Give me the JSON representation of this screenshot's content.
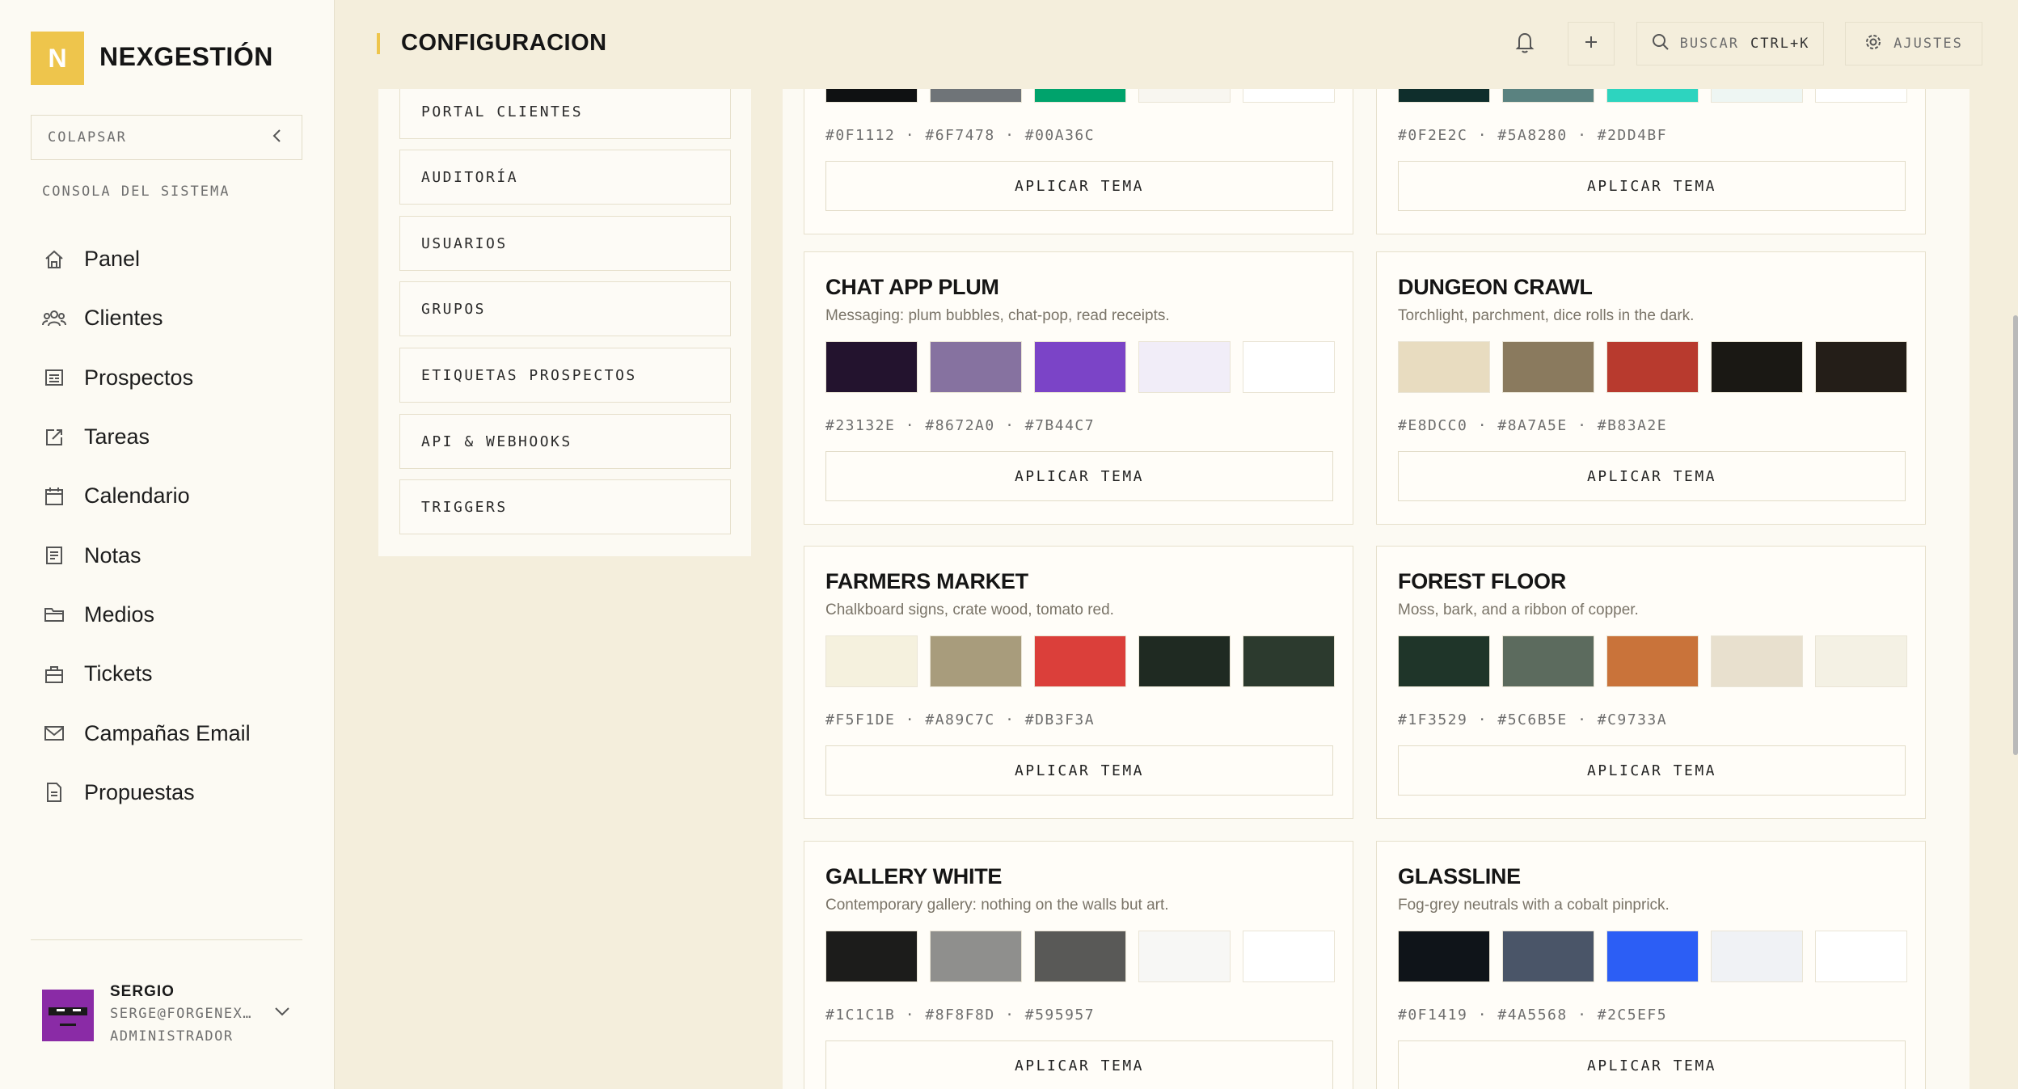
{
  "app": {
    "logo_letter": "N",
    "brand": "NEXGESTIÓN",
    "collapse_label": "COLAPSAR",
    "section_label": "CONSOLA DEL SISTEMA"
  },
  "sidebar": {
    "items": [
      {
        "label": "Panel",
        "icon": "home-icon"
      },
      {
        "label": "Clientes",
        "icon": "users-icon"
      },
      {
        "label": "Prospectos",
        "icon": "id-card-icon"
      },
      {
        "label": "Tareas",
        "icon": "edit-task-icon"
      },
      {
        "label": "Calendario",
        "icon": "calendar-icon"
      },
      {
        "label": "Notas",
        "icon": "note-icon"
      },
      {
        "label": "Medios",
        "icon": "folder-icon"
      },
      {
        "label": "Tickets",
        "icon": "ticket-icon"
      },
      {
        "label": "Campañas Email",
        "icon": "mail-icon"
      },
      {
        "label": "Propuestas",
        "icon": "document-icon"
      }
    ]
  },
  "user": {
    "name": "SERGIO",
    "email": "SERGE@FORGENEX…",
    "role": "ADMINISTRADOR"
  },
  "header": {
    "title": "CONFIGURACION",
    "search_label": "BUSCAR",
    "search_shortcut": "CTRL+K",
    "settings_label": "AJUSTES"
  },
  "settings_nav": {
    "items": [
      "PORTAL CLIENTES",
      "AUDITORÍA",
      "USUARIOS",
      "GRUPOS",
      "ETIQUETAS PROSPECTOS",
      "API & WEBHOOKS",
      "TRIGGERS"
    ]
  },
  "themes": {
    "apply_label": "APLICAR TEMA",
    "cards": [
      {
        "name": "",
        "desc": "",
        "colors": [
          "#0F1112",
          "#6F7478",
          "#00A36C",
          "#F8F6F0",
          "#FFFFFF"
        ],
        "hexes": "#0F1112 · #6F7478 · #00A36C"
      },
      {
        "name": "",
        "desc": "",
        "colors": [
          "#0F2E2C",
          "#5A8280",
          "#2DD4BF",
          "#EEF6F3",
          "#FFFFFF"
        ],
        "hexes": "#0F2E2C · #5A8280 · #2DD4BF"
      },
      {
        "name": "CHAT APP PLUM",
        "desc": "Messaging: plum bubbles, chat-pop, read receipts.",
        "colors": [
          "#23132E",
          "#8672A0",
          "#7B44C7",
          "#F1EDF8",
          "#FFFFFF"
        ],
        "hexes": "#23132E · #8672A0 · #7B44C7"
      },
      {
        "name": "DUNGEON CRAWL",
        "desc": "Torchlight, parchment, dice rolls in the dark.",
        "colors": [
          "#E8DCC0",
          "#8A7A5E",
          "#B83A2E",
          "#1A1814",
          "#241E18"
        ],
        "hexes": "#E8DCC0 · #8A7A5E · #B83A2E"
      },
      {
        "name": "FARMERS MARKET",
        "desc": "Chalkboard signs, crate wood, tomato red.",
        "colors": [
          "#F5F1DE",
          "#A89C7C",
          "#DB3F3A",
          "#1F2A22",
          "#2C3A2E"
        ],
        "hexes": "#F5F1DE · #A89C7C · #DB3F3A"
      },
      {
        "name": "FOREST FLOOR",
        "desc": "Moss, bark, and a ribbon of copper.",
        "colors": [
          "#1F3529",
          "#5C6B5E",
          "#C9733A",
          "#E8E0CE",
          "#F4F1E4"
        ],
        "hexes": "#1F3529 · #5C6B5E · #C9733A"
      },
      {
        "name": "GALLERY WHITE",
        "desc": "Contemporary gallery: nothing on the walls but art.",
        "colors": [
          "#1C1C1B",
          "#8F8F8D",
          "#595957",
          "#F7F7F5",
          "#FFFFFF"
        ],
        "hexes": "#1C1C1B · #8F8F8D · #595957"
      },
      {
        "name": "GLASSLINE",
        "desc": "Fog-grey neutrals with a cobalt pinprick.",
        "colors": [
          "#0F1419",
          "#4A5568",
          "#2C5EF5",
          "#F0F2F5",
          "#FFFFFF"
        ],
        "hexes": "#0F1419 · #4A5568 · #2C5EF5"
      }
    ]
  }
}
